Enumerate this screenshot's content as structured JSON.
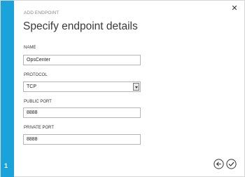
{
  "wizard": {
    "caption": "ADD ENDPOINT",
    "title": "Specify endpoint details",
    "step": "1"
  },
  "fields": {
    "name": {
      "label": "NAME",
      "value": "OpsCenter"
    },
    "protocol": {
      "label": "PROTOCOL",
      "value": "TCP"
    },
    "public_port": {
      "label": "PUBLIC PORT",
      "value": "8888"
    },
    "private_port": {
      "label": "PRIVATE PORT",
      "value": "8888"
    }
  },
  "icons": {
    "close": "close-icon",
    "back": "back-arrow-icon",
    "complete": "checkmark-icon",
    "dropdown": "chevron-down-icon"
  },
  "colors": {
    "accent": "#1aa3da"
  }
}
